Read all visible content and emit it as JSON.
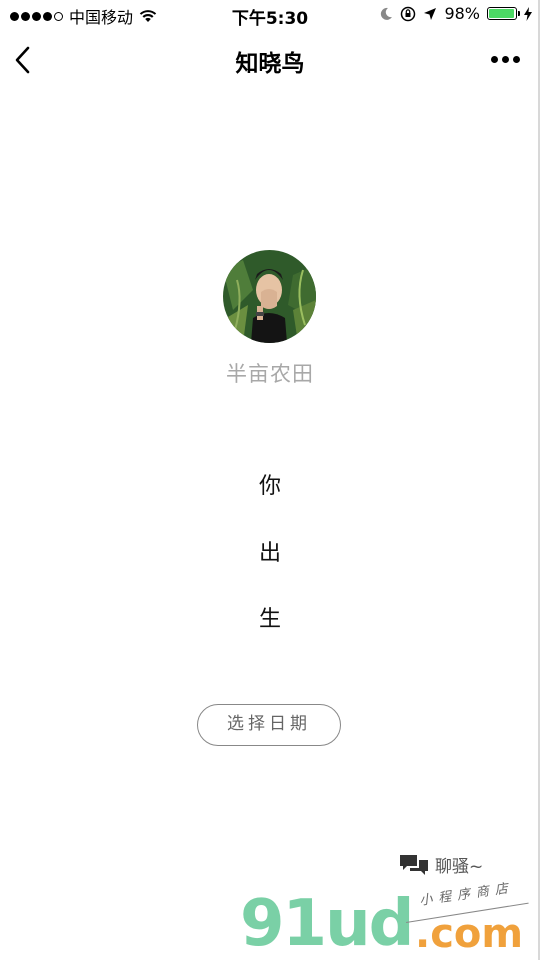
{
  "status_bar": {
    "carrier": "中国移动",
    "time": "下午5:30",
    "battery_percent": "98%",
    "battery_level": 0.98,
    "signal_bars_filled": 4,
    "signal_bars_total": 5
  },
  "nav": {
    "title": "知晓鸟"
  },
  "profile": {
    "username": "半亩农田"
  },
  "prompt": {
    "line1": "你",
    "line2": "出",
    "line3": "生"
  },
  "actions": {
    "select_date": "选择日期"
  },
  "chat": {
    "label": "聊骚~"
  },
  "watermark": {
    "main": "91ud",
    "suffix": ".com",
    "subtitle": "小程序商店"
  },
  "colors": {
    "battery": "#4cd964",
    "watermark_green": "#7ad0a6",
    "watermark_orange": "#f0a13c",
    "muted_text": "#a8a8a8"
  }
}
